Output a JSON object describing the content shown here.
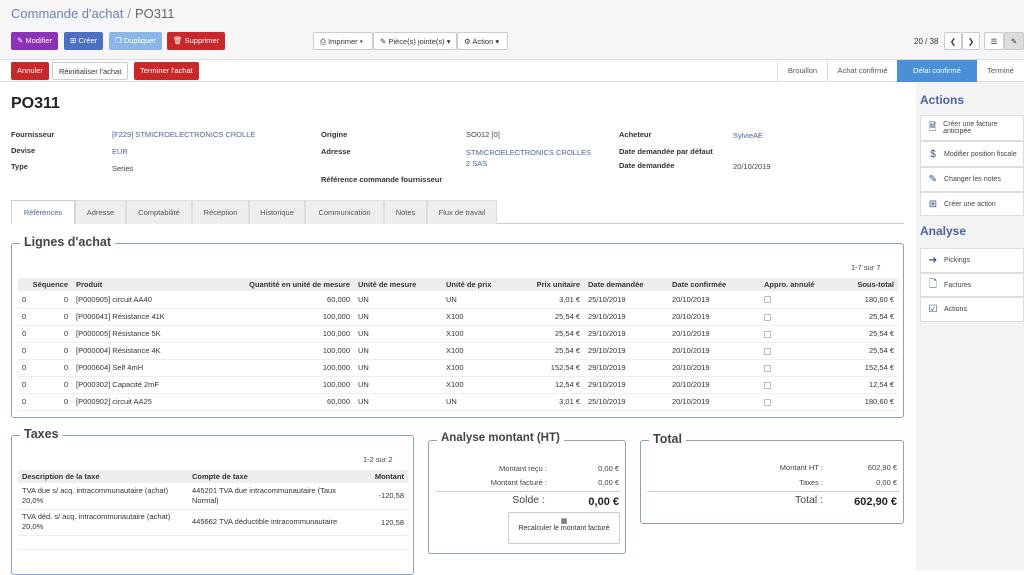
{
  "breadcrumb": {
    "parent": "Commande d'achat",
    "sep": "/",
    "current": "PO311"
  },
  "toolbar": {
    "edit": "Modifier",
    "create": "Créer",
    "duplicate": "Dupliquer",
    "delete": "Supprimer",
    "print": "Imprimer",
    "attach": "Pièce(s) jointe(s)",
    "action": "Action",
    "pager": "20 / 38"
  },
  "statusbar": {
    "cancel": "Annuler",
    "reset": "Réinitialiser l'achat",
    "done": "Terminer l'achat",
    "stages": [
      "Brouillon",
      "Achat confirmé",
      "Délai confirmé",
      "Terminé"
    ]
  },
  "form": {
    "title": "PO311",
    "fournisseur_lbl": "Fournisseur",
    "fournisseur": "[F229] STMICROELECTRONICS CROLLE",
    "devise_lbl": "Devise",
    "devise": "EUR",
    "type_lbl": "Type",
    "type": "Series",
    "origine_lbl": "Origine",
    "origine": "SO012 [0]",
    "adresse_lbl": "Adresse",
    "adresse1": "STMICROELECTRONICS CROLLES",
    "adresse2": "2 SAS",
    "ref_lbl": "Référence commande fournisseur",
    "acheteur_lbl": "Acheteur",
    "acheteur": "SylvieAE",
    "date_def_lbl": "Date demandée par défaut",
    "date_lbl": "Date demandée",
    "date": "20/10/2019"
  },
  "tabs": [
    "Références",
    "Adresse",
    "Comptabilité",
    "Réception",
    "Historique",
    "Communication",
    "Notes",
    "Flux de travail"
  ],
  "lines": {
    "title": "Lignes d'achat",
    "pager": "1-7 sur 7",
    "headers": [
      "Séquence",
      "Produit",
      "Quantité en unité de mesure",
      "Unité de mesure",
      "Unité de prix",
      "Prix unitaire",
      "Date demandée",
      "Date confirmée",
      "Appro. annulé",
      "Sous-total"
    ],
    "rows": [
      [
        "0",
        "0",
        "[P000905] circuit AA40",
        "60,000",
        "UN",
        "UN",
        "3,01 €",
        "25/10/2019",
        "20/10/2019",
        "180,60 €"
      ],
      [
        "0",
        "0",
        "[P000041] Résistance 41K",
        "100,000",
        "UN",
        "X100",
        "25,54 €",
        "29/10/2019",
        "20/10/2019",
        "25,54 €"
      ],
      [
        "0",
        "0",
        "[P000005] Résistance 5K",
        "100,000",
        "UN",
        "X100",
        "25,54 €",
        "29/10/2019",
        "20/10/2019",
        "25,54 €"
      ],
      [
        "0",
        "0",
        "[P000004] Résistance 4K",
        "100,000",
        "UN",
        "X100",
        "25,54 €",
        "29/10/2019",
        "20/10/2019",
        "25,54 €"
      ],
      [
        "0",
        "0",
        "[P000604] Self 4mH",
        "100,000",
        "UN",
        "X100",
        "152,54 €",
        "29/10/2019",
        "20/10/2019",
        "152,54 €"
      ],
      [
        "0",
        "0",
        "[P000302] Capacité 2mF",
        "100,000",
        "UN",
        "X100",
        "12,54 €",
        "29/10/2019",
        "20/10/2019",
        "12,54 €"
      ],
      [
        "0",
        "0",
        "[P000902] circuit AA25",
        "60,000",
        "UN",
        "UN",
        "3,01 €",
        "25/10/2019",
        "20/10/2019",
        "180,60 €"
      ]
    ]
  },
  "taxes": {
    "title": "Taxes",
    "pager": "1-2 sur 2",
    "headers": [
      "Description de la taxe",
      "Compte de taxe",
      "Montant"
    ],
    "rows": [
      {
        "desc1": "TVA due s/ acq. intracommunautaire (achat)",
        "desc2": "20,0%",
        "acc1": "445201 TVA due intracommunautaire (Taux",
        "acc2": "Normal)",
        "amount": "-120,58"
      },
      {
        "desc1": "TVA déd. s/ acq. intracommunautaire (achat)",
        "desc2": "20,0%",
        "acc1": "445662 TVA déductible intracommunautaire",
        "acc2": "",
        "amount": "120,58"
      }
    ]
  },
  "analyse": {
    "title": "Analyse montant (HT)",
    "recu_lbl": "Montant reçu :",
    "recu": "0,00 €",
    "facture_lbl": "Montant facturé :",
    "facture": "0,00 €",
    "solde_lbl": "Solde :",
    "solde": "0,00 €",
    "recalc": "Recalculer le montant facturé"
  },
  "total": {
    "title": "Total",
    "ht_lbl": "Montant HT :",
    "ht": "602,90 €",
    "taxes_lbl": "Taxes :",
    "taxes": "0,00 €",
    "total_lbl": "Total :",
    "total": "602,90 €"
  },
  "sidebar": {
    "actions_title": "Actions",
    "actions": [
      "Créer une facture anticipée",
      "Modifier position fiscale",
      "Changer les notes",
      "Créer une action"
    ],
    "analyse_title": "Analyse",
    "analyse": [
      "Pickings",
      "Factures",
      "Actions"
    ]
  }
}
